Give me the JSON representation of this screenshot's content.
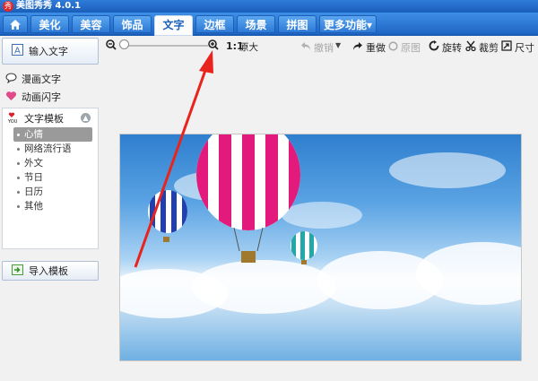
{
  "window": {
    "title": "美图秀秀 4.0.1",
    "logo_char": "秀"
  },
  "menu": {
    "home_icon": "home-icon",
    "tabs": [
      {
        "label": "美化"
      },
      {
        "label": "美容"
      },
      {
        "label": "饰品"
      },
      {
        "label": "文字",
        "active": true
      },
      {
        "label": "边框"
      },
      {
        "label": "场景"
      },
      {
        "label": "拼图"
      },
      {
        "label": "更多功能▾"
      }
    ]
  },
  "toolbar": {
    "zoom_ratio": "1:1",
    "original_size": "原大",
    "undo": "撤销",
    "redo": "重做",
    "restore": "原图",
    "rotate": "旋转",
    "crop": "裁剪",
    "resize": "尺寸"
  },
  "sidebar": {
    "input_text": "输入文字",
    "comic_text": "漫画文字",
    "animated_text": "动画闪字",
    "template_title": "文字模板",
    "categories": [
      "心情",
      "网络流行语",
      "外文",
      "节日",
      "日历",
      "其他"
    ],
    "selected_category": "心情",
    "import_template": "导入模板"
  },
  "colors": {
    "accent": "#1f66c4",
    "annotation_arrow": "#e8241c"
  }
}
